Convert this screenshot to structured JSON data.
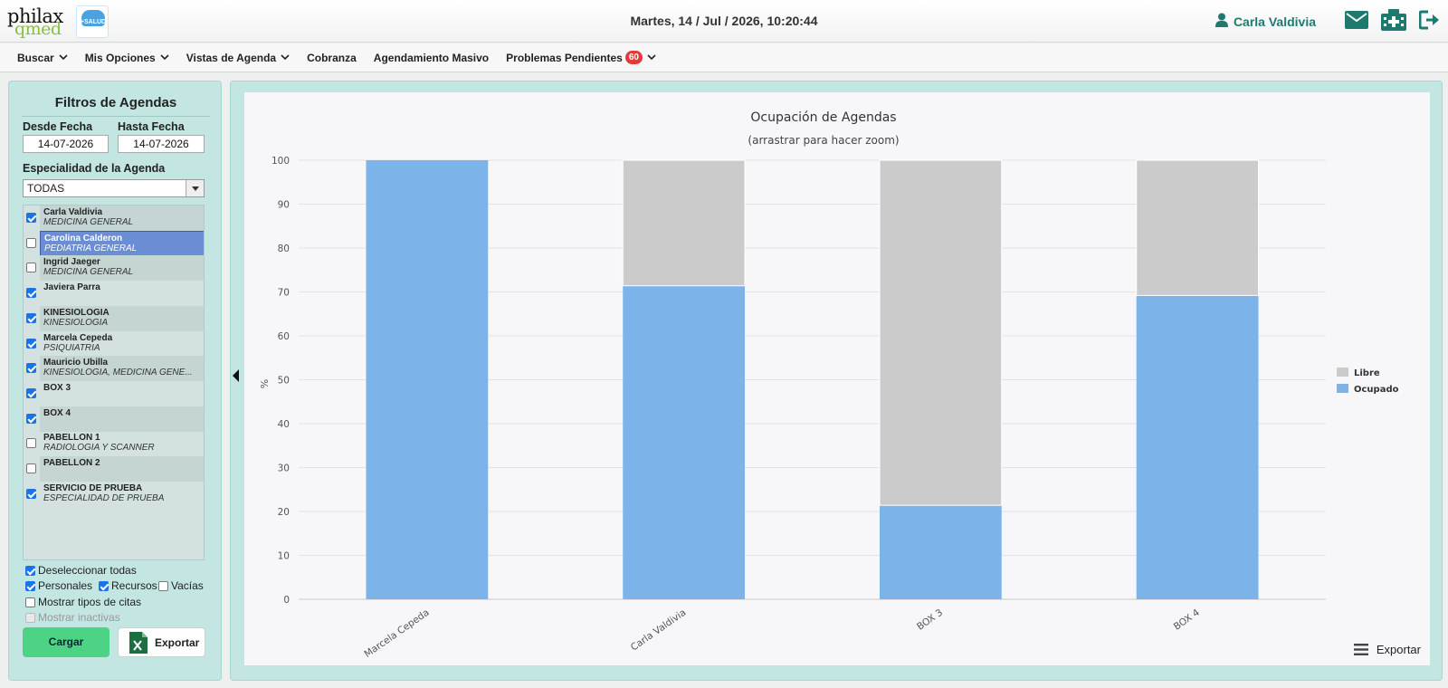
{
  "header": {
    "logo_text_top": "philax",
    "logo_text_bottom": "qmed",
    "salud_logo_text": "+SALUD",
    "datetime": "Martes, 14 / Jul / 2026, 10:20:44",
    "user_name": "Carla Valdivia",
    "icons": [
      "user-icon",
      "mail-icon",
      "hospital-icon",
      "logout-icon"
    ],
    "accent_color": "#1e7a6f"
  },
  "nav": {
    "items": [
      {
        "label": "Buscar",
        "dropdown": true
      },
      {
        "label": "Mis Opciones",
        "dropdown": true
      },
      {
        "label": "Vistas de Agenda",
        "dropdown": true
      },
      {
        "label": "Cobranza",
        "dropdown": false
      },
      {
        "label": "Agendamiento Masivo",
        "dropdown": false
      },
      {
        "label": "Problemas Pendientes",
        "dropdown": true,
        "badge": "60"
      }
    ]
  },
  "filters": {
    "title": "Filtros de Agendas",
    "desde_label": "Desde Fecha",
    "hasta_label": "Hasta Fecha",
    "desde_value": "14-07-2026",
    "hasta_value": "14-07-2026",
    "especialidad_label": "Especialidad de la Agenda",
    "especialidad_value": "TODAS",
    "agendas": [
      {
        "name": "Carla Valdivia",
        "specialty": "MEDICINA GENERAL",
        "checked": true,
        "selected": false
      },
      {
        "name": "Carolina Calderon",
        "specialty": "PEDIATRIA GENERAL",
        "checked": false,
        "selected": true
      },
      {
        "name": "Ingrid Jaeger",
        "specialty": "MEDICINA GENERAL",
        "checked": false,
        "selected": false
      },
      {
        "name": "Javiera Parra",
        "specialty": "",
        "checked": true,
        "selected": false
      },
      {
        "name": "KINESIOLOGIA",
        "specialty": "KINESIOLOGIA",
        "checked": true,
        "selected": false
      },
      {
        "name": "Marcela Cepeda",
        "specialty": "PSIQUIATRIA",
        "checked": true,
        "selected": false
      },
      {
        "name": "Mauricio Ubilla",
        "specialty": "KINESIOLOGIA, MEDICINA GENE...",
        "checked": true,
        "selected": false
      },
      {
        "name": "BOX 3",
        "specialty": "",
        "checked": true,
        "selected": false
      },
      {
        "name": "BOX 4",
        "specialty": "",
        "checked": true,
        "selected": false
      },
      {
        "name": "PABELLON 1",
        "specialty": "RADIOLOGIA Y SCANNER",
        "checked": false,
        "selected": false
      },
      {
        "name": "PABELLON 2",
        "specialty": "",
        "checked": false,
        "selected": false
      },
      {
        "name": "SERVICIO DE PRUEBA",
        "specialty": "ESPECIALIDAD DE PRUEBA",
        "checked": true,
        "selected": false
      }
    ],
    "options": {
      "deseleccionar": {
        "label": "Deseleccionar todas",
        "checked": true
      },
      "personales": {
        "label": "Personales",
        "checked": true
      },
      "recursos": {
        "label": "Recursos",
        "checked": true
      },
      "vacias": {
        "label": "Vacías",
        "checked": false
      },
      "tipos": {
        "label": "Mostrar tipos de citas",
        "checked": false
      },
      "inactivas": {
        "label": "Mostrar inactivas",
        "checked": false,
        "disabled": true
      }
    },
    "cargar_label": "Cargar",
    "exportar_label": "Exportar"
  },
  "chart_data": {
    "type": "bar",
    "stacked": true,
    "title": "Ocupación de Agendas",
    "subtitle": "(arrastrar para hacer zoom)",
    "ylabel": "%",
    "ylim": [
      0,
      100
    ],
    "yticks": [
      0,
      10,
      20,
      30,
      40,
      50,
      60,
      70,
      80,
      90,
      100
    ],
    "categories": [
      "Marcela Cepeda",
      "Carla Valdivia",
      "BOX 3",
      "BOX 4"
    ],
    "series": [
      {
        "name": "Libre",
        "color": "#cbcbcb",
        "values": [
          0,
          28.6,
          78.6,
          30.8
        ]
      },
      {
        "name": "Ocupado",
        "color": "#7cb4ea",
        "values": [
          100,
          71.4,
          21.4,
          69.2
        ]
      }
    ],
    "legend_position": "right",
    "grid": true
  },
  "chart_export_label": "Exportar"
}
